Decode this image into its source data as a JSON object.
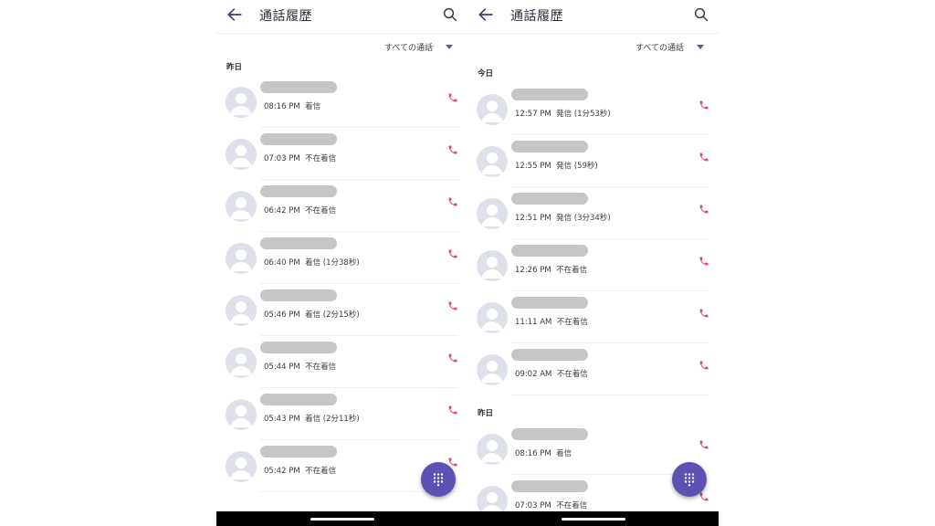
{
  "colors": {
    "accent": "#5d52b4",
    "phone_icon": "#e0457d",
    "redaction": "#c6c6c8"
  },
  "icons": {
    "back": "arrow-left-icon",
    "search": "search-icon",
    "filter": "caret-down-icon",
    "avatar": "person-icon",
    "call": "phone-icon",
    "fab": "dialpad-icon"
  },
  "left": {
    "title": "通話履歴",
    "filter_label": "すべての通話",
    "sections": [
      {
        "label": "昨日",
        "items": [
          {
            "time": "08:16 PM",
            "status": "着信"
          },
          {
            "time": "07:03 PM",
            "status": "不在着信"
          },
          {
            "time": "06:42 PM",
            "status": "不在着信"
          },
          {
            "time": "06:40 PM",
            "status": "着信 (1分38秒)"
          },
          {
            "time": "05:46 PM",
            "status": "着信 (2分15秒)"
          },
          {
            "time": "05:44 PM",
            "status": "不在着信"
          },
          {
            "time": "05:43 PM",
            "status": "着信 (2分11秒)"
          },
          {
            "time": "05:42 PM",
            "status": "不在着信"
          }
        ]
      }
    ]
  },
  "right": {
    "title": "通話履歴",
    "filter_label": "すべての通話",
    "sections": [
      {
        "label": "今日",
        "items": [
          {
            "time": "12:57 PM",
            "status": "発信 (1分53秒)"
          },
          {
            "time": "12:55 PM",
            "status": "発信 (59秒)"
          },
          {
            "time": "12:51 PM",
            "status": "発信 (3分34秒)"
          },
          {
            "time": "12:26 PM",
            "status": "不在着信"
          },
          {
            "time": "11:11 AM",
            "status": "不在着信"
          },
          {
            "time": "09:02 AM",
            "status": "不在着信"
          }
        ]
      },
      {
        "label": "昨日",
        "items": [
          {
            "time": "08:16 PM",
            "status": "着信"
          },
          {
            "time": "07:03 PM",
            "status": "不在着信"
          }
        ]
      }
    ]
  }
}
